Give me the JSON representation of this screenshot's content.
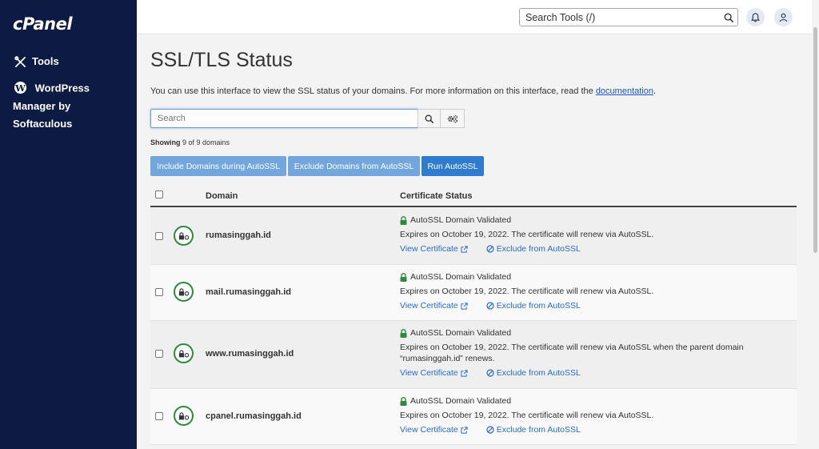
{
  "sidebar": {
    "logo": "cPanel",
    "items": [
      {
        "label": "Tools",
        "icon": "tools-icon"
      },
      {
        "label": "WordPress Manager by Softaculous",
        "icon": "wordpress-icon"
      }
    ]
  },
  "header": {
    "search_placeholder": "Search Tools (/)"
  },
  "page": {
    "title": "SSL/TLS Status",
    "intro_text": "You can use this interface to view the SSL status of your domains. For more information on this interface, read the ",
    "intro_link": "documentation",
    "intro_end": "."
  },
  "search": {
    "placeholder": "Search"
  },
  "showing": {
    "label": "Showing",
    "text": "9 of 9 domains"
  },
  "buttons": {
    "include": "Include Domains during AutoSSL",
    "exclude": "Exclude Domains from AutoSSL",
    "run": "Run AutoSSL"
  },
  "table": {
    "col_domain": "Domain",
    "col_status": "Certificate Status",
    "rows": [
      {
        "domain": "rumasinggah.id",
        "status": "AutoSSL Domain Validated",
        "expires": "Expires on October 19, 2022. The certificate will renew via AutoSSL.",
        "view": "View Certificate",
        "exclude": "Exclude from AutoSSL"
      },
      {
        "domain": "mail.rumasinggah.id",
        "status": "AutoSSL Domain Validated",
        "expires": "Expires on October 19, 2022. The certificate will renew via AutoSSL.",
        "view": "View Certificate",
        "exclude": "Exclude from AutoSSL"
      },
      {
        "domain": "www.rumasinggah.id",
        "status": "AutoSSL Domain Validated",
        "expires": "Expires on October 19, 2022. The certificate will renew via AutoSSL when the parent domain",
        "expires2": "“rumasinggah.id” renews.",
        "view": "View Certificate",
        "exclude": "Exclude from AutoSSL"
      },
      {
        "domain": "cpanel.rumasinggah.id",
        "status": "AutoSSL Domain Validated",
        "expires": "Expires on October 19, 2022. The certificate will renew via AutoSSL.",
        "view": "View Certificate",
        "exclude": "Exclude from AutoSSL"
      }
    ]
  },
  "colors": {
    "sidebar_bg": "#0d1a44",
    "validated_green": "#2e8b3e",
    "link_blue": "#2b6bc4",
    "primary_button": "#2f7bd0",
    "secondary_button": "#73a6dd"
  }
}
